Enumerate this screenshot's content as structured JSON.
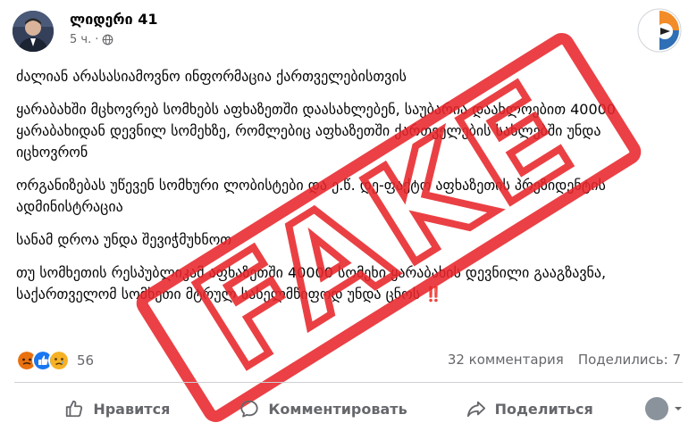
{
  "post": {
    "page_name": "ლიდერი 41",
    "time": "5 ч.",
    "paragraphs": [
      "ძალიან არასასიამოვნო ინფორმაცია ქართველებისთვის",
      "ყარაბახში მცხოვრებ სომხებს აფხაზეთში დაასახლებენ, საუბარია დაახლოებით 40000 ყარაბახიდან დევნილ სომეხზე, რომლებიც აფხაზეთში ქართველების სახლებში უნდა იცხოვრონ",
      "ორგანიზებას უწევენ სომხური ლობისტები და ე.წ. დე-ფაქტო აფხაზეთის პრეზიდენტის ადმინისტრაცია",
      "სანამ დროა უნდა შევიჭმუხნოთ",
      "თუ სომხეთის რესპუბლიკამ აფხაზეთში 40000 სომეხი ყარაბახის დევნილი გააგზავნა, საქართველომ სომხეთი მტრულ სახელმწიფოდ უნდა ცნოს"
    ],
    "emphasis": "‼️",
    "stamp_text": "FAKE"
  },
  "stats": {
    "reactions_count": "56",
    "comments": "32 комментария",
    "shares": "Поделились: 7"
  },
  "actions": {
    "like": "Нравится",
    "comment": "Комментировать",
    "share": "Поделиться"
  },
  "colors": {
    "stamp_red": "#e8262b",
    "muted": "#65676b",
    "angry": "#e9710f",
    "like_blue": "#1877f2",
    "sad": "#f7b125"
  }
}
